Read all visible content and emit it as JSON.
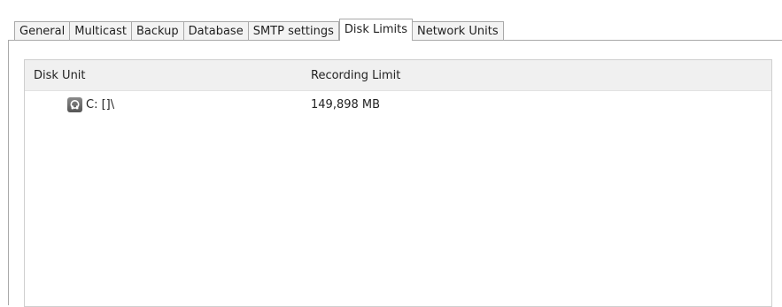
{
  "tabs": [
    {
      "label": "General",
      "active": false
    },
    {
      "label": "Multicast",
      "active": false
    },
    {
      "label": "Backup",
      "active": false
    },
    {
      "label": "Database",
      "active": false
    },
    {
      "label": "SMTP settings",
      "active": false
    },
    {
      "label": "Disk Limits",
      "active": true
    },
    {
      "label": "Network Units",
      "active": false
    }
  ],
  "grid": {
    "columns": [
      "Disk Unit",
      "Recording Limit"
    ],
    "rows": [
      {
        "disk_unit": "C: []\\",
        "recording_limit": "149,898 MB",
        "icon": "disk-drive-icon"
      }
    ]
  },
  "colors": {
    "tab_inactive_bg": "#f3f3f3",
    "header_bg": "#f0f0f0",
    "border": "#a9a9a9"
  }
}
